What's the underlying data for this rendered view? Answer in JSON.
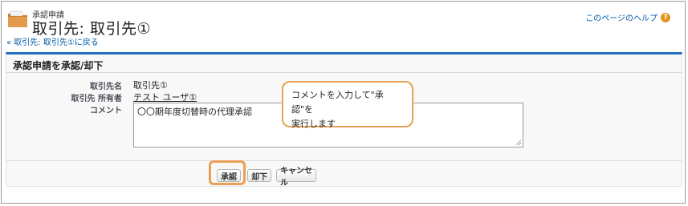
{
  "header": {
    "kicker": "承認申請",
    "title": "取引先: 取引先①",
    "help_link": "このページのヘルプ",
    "back_link": "« 取引先: 取引先①に戻る"
  },
  "panel": {
    "title": "承認申請を承認/却下",
    "fields": {
      "account_label": "取引先名",
      "account_value": "取引先①",
      "owner_label": "取引先 所有者",
      "owner_value": "テスト ユーザ①",
      "comment_label": "コメント",
      "comment_value": "〇〇期年度切替時の代理承認"
    },
    "buttons": {
      "approve": "承認",
      "reject": "却下",
      "cancel": "キャンセル"
    }
  },
  "callout": {
    "line1": "コメントを入力して\"承認\"を",
    "line2": "実行します"
  },
  "colors": {
    "accent_blue": "#236fbd",
    "link_blue": "#015ba7",
    "highlight_orange": "#e8a055",
    "help_orange": "#e39321"
  }
}
